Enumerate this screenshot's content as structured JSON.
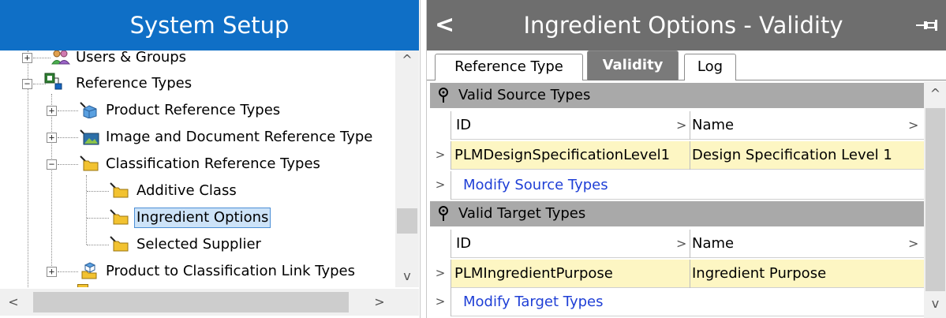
{
  "left": {
    "title": "System Setup",
    "tree": [
      {
        "label": "Users & Groups",
        "icon": "users-groups-icon",
        "expander": "+"
      },
      {
        "label": "Reference Types",
        "icon": "reference-types-icon",
        "expander": "−"
      },
      {
        "label": "Product Reference Types",
        "icon": "product-cube-icon",
        "expander": "+"
      },
      {
        "label": "Image and Document Reference Type",
        "icon": "image-icon",
        "expander": "+"
      },
      {
        "label": "Classification Reference Types",
        "icon": "folder-icon",
        "expander": "−"
      },
      {
        "label": "Additive Class",
        "icon": "folder-icon"
      },
      {
        "label": "Ingredient Options",
        "icon": "folder-icon",
        "selected": true
      },
      {
        "label": "Selected Supplier",
        "icon": "folder-icon"
      },
      {
        "label": "Product to Classification Link Types",
        "icon": "link-types-icon",
        "expander": "+"
      }
    ],
    "scroll_up": "^",
    "scroll_down": "v",
    "scroll_left": "<",
    "scroll_right": ">"
  },
  "right": {
    "title": "Ingredient Options - Validity",
    "back": "<",
    "tabs": [
      {
        "label": "Reference Type",
        "active": false
      },
      {
        "label": "Validity",
        "active": true
      },
      {
        "label": "Log",
        "active": false
      }
    ],
    "source": {
      "header": "Valid Source Types",
      "col_id": "ID",
      "col_name": "Name",
      "row_id": "PLMDesignSpecificationLevel1",
      "row_name": "Design Specification Level 1",
      "modify": "Modify Source Types"
    },
    "target": {
      "header": "Valid Target Types",
      "col_id": "ID",
      "col_name": "Name",
      "row_id": "PLMIngredientPurpose",
      "row_name": "Ingredient Purpose",
      "modify": "Modify Target Types"
    },
    "row_chevron": ">",
    "scroll_up": "^",
    "scroll_down": "v"
  },
  "colors": {
    "left_title_bg": "#0f6fc6",
    "right_header_bg": "#6e6e6e",
    "selected_row_bg": "#fdf6c3",
    "link": "#1f3fd6"
  }
}
